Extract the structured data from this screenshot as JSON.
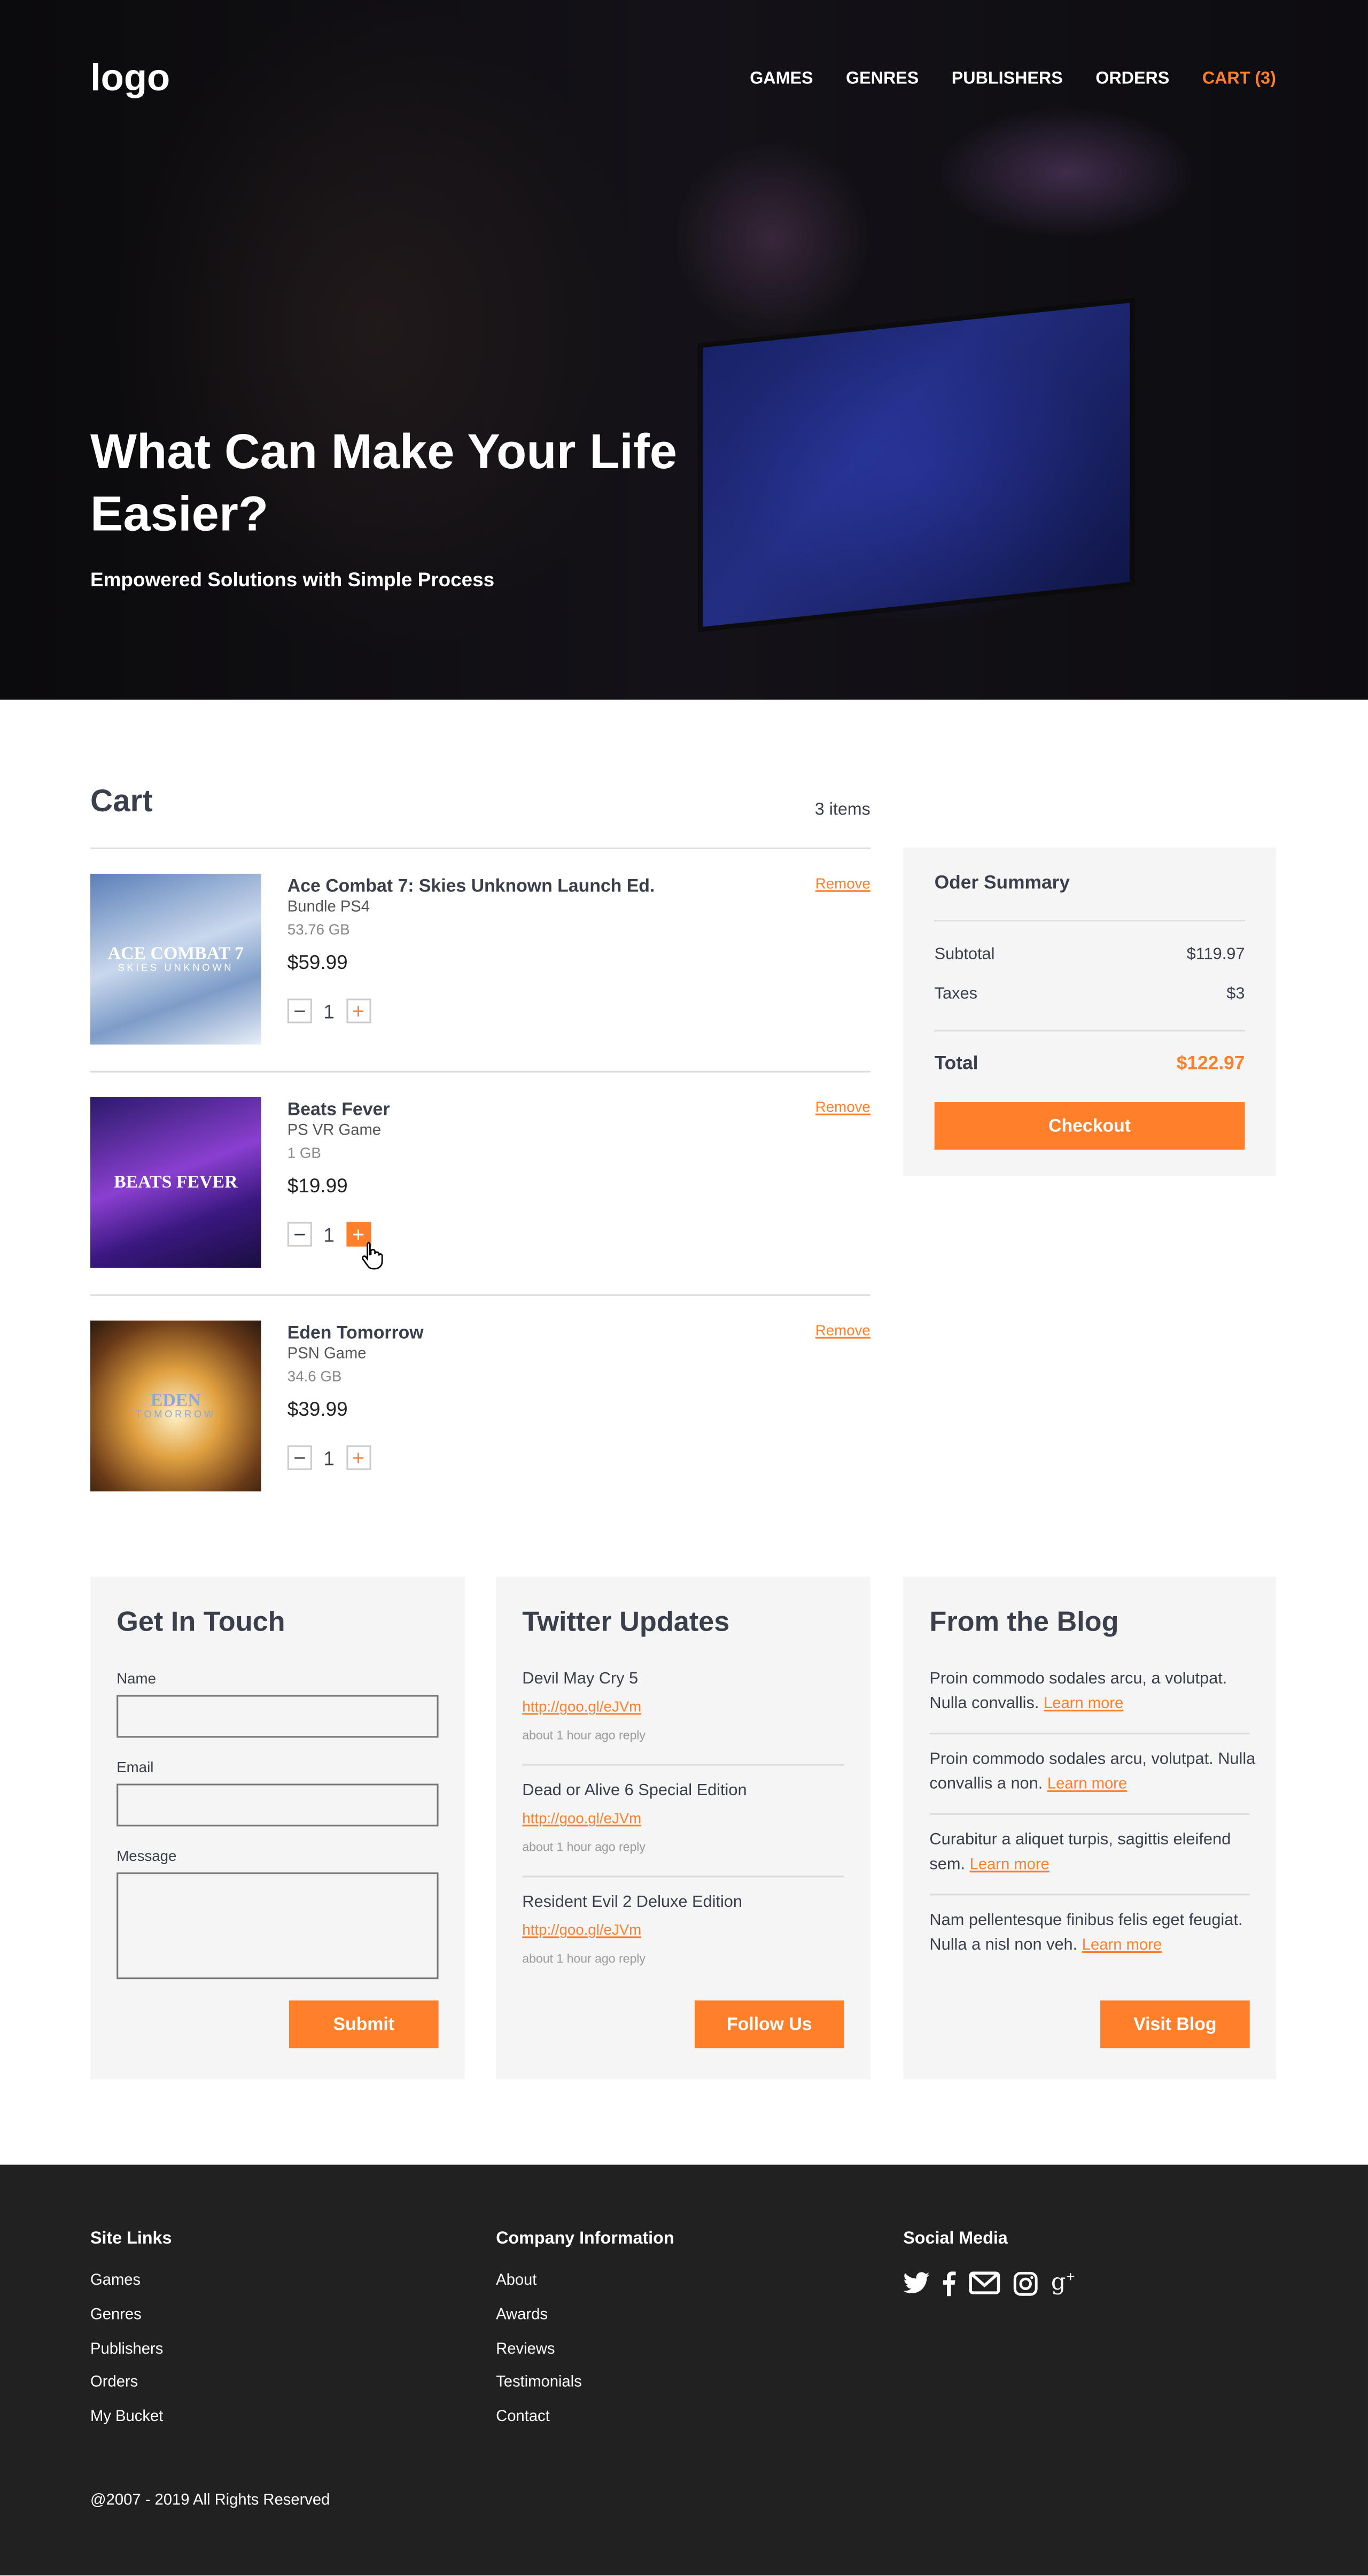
{
  "header": {
    "logo": "logo",
    "nav": [
      "GAMES",
      "GENRES",
      "PUBLISHERS",
      "ORDERS"
    ],
    "cart": "CART (3)"
  },
  "hero": {
    "title": "What Can Make Your Life Easier?",
    "subtitle": "Empowered Solutions with Simple Process"
  },
  "cart": {
    "title": "Cart",
    "count": "3 items",
    "remove_label": "Remove",
    "items": [
      {
        "name": "Ace Combat 7: Skies Unknown Launch Ed.",
        "platform": "Bundle PS4",
        "size": "53.76 GB",
        "price": "$59.99",
        "qty": "1",
        "cover": "ACE COMBAT 7",
        "cover_sub": "SKIES UNKNOWN"
      },
      {
        "name": "Beats Fever",
        "platform": "PS VR Game",
        "size": "1 GB",
        "price": "$19.99",
        "qty": "1",
        "cover": "BEATS FEVER",
        "cover_sub": ""
      },
      {
        "name": "Eden Tomorrow",
        "platform": "PSN Game",
        "size": "34.6 GB",
        "price": "$39.99",
        "qty": "1",
        "cover": "EDEN",
        "cover_sub": "TOMORROW"
      }
    ]
  },
  "summary": {
    "title": "Oder Summary",
    "subtotal_label": "Subtotal",
    "subtotal": "$119.97",
    "taxes_label": "Taxes",
    "taxes": "$3",
    "total_label": "Total",
    "total": "$122.97",
    "checkout": "Checkout"
  },
  "contact": {
    "title": "Get In Touch",
    "name_label": "Name",
    "email_label": "Email",
    "message_label": "Message",
    "submit": "Submit"
  },
  "twitter": {
    "title": "Twitter Updates",
    "tweets": [
      {
        "text": "Devil May Cry 5",
        "link": "http://goo.gl/eJVm",
        "meta": "about 1 hour ago reply"
      },
      {
        "text": "Dead or Alive 6 Special Edition",
        "link": "http://goo.gl/eJVm",
        "meta": "about 1 hour ago reply"
      },
      {
        "text": "Resident Evil 2 Deluxe Edition",
        "link": "http://goo.gl/eJVm",
        "meta": "about 1 hour ago reply"
      }
    ],
    "button": "Follow Us"
  },
  "blog": {
    "title": "From the Blog",
    "learn_more": "Learn more",
    "posts": [
      "Proin commodo sodales arcu, a volutpat. Nulla convallis.",
      "Proin commodo sodales arcu, volutpat. Nulla convallis a non.",
      "Curabitur a aliquet turpis, sagittis eleifend sem.",
      "Nam pellentesque finibus felis eget feugiat. Nulla a nisl non veh."
    ],
    "button": "Visit Blog"
  },
  "footer": {
    "site_links_title": "Site Links",
    "site_links": [
      "Games",
      "Genres",
      "Publishers",
      "Orders",
      "My Bucket"
    ],
    "company_title": "Company Information",
    "company_links": [
      "About",
      "Awards",
      "Reviews",
      "Testimonials",
      "Contact"
    ],
    "social_title": "Social Media",
    "social_icons": [
      "twitter-icon",
      "facebook-icon",
      "mail-icon",
      "instagram-icon",
      "google-plus-icon"
    ],
    "copyright": "@2007 - 2019 All Rights Reserved"
  },
  "colors": {
    "accent": "#ff7f2a",
    "footer_bg": "#212121",
    "panel_bg": "#f5f5f5",
    "text": "#3a3f4b"
  }
}
